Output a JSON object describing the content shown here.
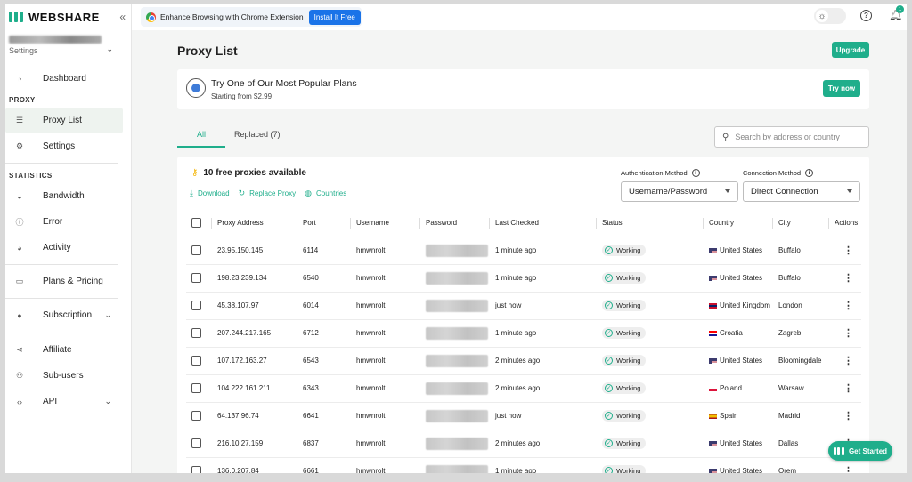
{
  "brand": {
    "name": "WEBSHARE",
    "color": "#1fae8b"
  },
  "sidebar": {
    "collapse_icon": "«",
    "account_sub": "Settings",
    "sections": {
      "proxy": "PROXY",
      "statistics": "STATISTICS"
    },
    "items": {
      "dashboard": "Dashboard",
      "proxy_list": "Proxy List",
      "settings": "Settings",
      "bandwidth": "Bandwidth",
      "error": "Error",
      "activity": "Activity",
      "plans": "Plans & Pricing",
      "subscription": "Subscription",
      "affiliate": "Affiliate",
      "subusers": "Sub-users",
      "api": "API"
    }
  },
  "topbar": {
    "extension_text": "Enhance Browsing with Chrome Extension",
    "install_label": "Install It Free",
    "notification_count": "1"
  },
  "main": {
    "title": "Proxy List",
    "upgrade_label": "Upgrade",
    "plan_card": {
      "title": "Try One of Our Most Popular Plans",
      "subtitle": "Starting from $2.99",
      "cta": "Try now"
    },
    "tabs": {
      "all": "All",
      "replaced": "Replaced (7)"
    },
    "search_placeholder": "Search by address or country",
    "free_text": "10 free proxies available",
    "actions": {
      "download": "Download",
      "replace": "Replace Proxy",
      "countries": "Countries"
    },
    "auth": {
      "label": "Authentication Method",
      "value": "Username/Password"
    },
    "connection": {
      "label": "Connection Method",
      "value": "Direct Connection"
    },
    "table": {
      "headers": {
        "address": "Proxy Address",
        "port": "Port",
        "username": "Username",
        "password": "Password",
        "last_checked": "Last Checked",
        "status": "Status",
        "country": "Country",
        "city": "City",
        "actions": "Actions"
      },
      "rows": [
        {
          "address": "23.95.150.145",
          "port": "6114",
          "username": "hmwnrolt",
          "last_checked": "1 minute ago",
          "status": "Working",
          "country": "United States",
          "city": "Buffalo"
        },
        {
          "address": "198.23.239.134",
          "port": "6540",
          "username": "hmwnrolt",
          "last_checked": "1 minute ago",
          "status": "Working",
          "country": "United States",
          "city": "Buffalo"
        },
        {
          "address": "45.38.107.97",
          "port": "6014",
          "username": "hmwnrolt",
          "last_checked": "just now",
          "status": "Working",
          "country": "United Kingdom",
          "city": "London"
        },
        {
          "address": "207.244.217.165",
          "port": "6712",
          "username": "hmwnrolt",
          "last_checked": "1 minute ago",
          "status": "Working",
          "country": "Croatia",
          "city": "Zagreb"
        },
        {
          "address": "107.172.163.27",
          "port": "6543",
          "username": "hmwnrolt",
          "last_checked": "2 minutes ago",
          "status": "Working",
          "country": "United States",
          "city": "Bloomingdale"
        },
        {
          "address": "104.222.161.211",
          "port": "6343",
          "username": "hmwnrolt",
          "last_checked": "2 minutes ago",
          "status": "Working",
          "country": "Poland",
          "city": "Warsaw"
        },
        {
          "address": "64.137.96.74",
          "port": "6641",
          "username": "hmwnrolt",
          "last_checked": "just now",
          "status": "Working",
          "country": "Spain",
          "city": "Madrid"
        },
        {
          "address": "216.10.27.159",
          "port": "6837",
          "username": "hmwnrolt",
          "last_checked": "2 minutes ago",
          "status": "Working",
          "country": "United States",
          "city": "Dallas"
        },
        {
          "address": "136.0.207.84",
          "port": "6661",
          "username": "hmwnrolt",
          "last_checked": "1 minute ago",
          "status": "Working",
          "country": "United States",
          "city": "Orem"
        }
      ]
    }
  },
  "get_started_label": "Get Started"
}
